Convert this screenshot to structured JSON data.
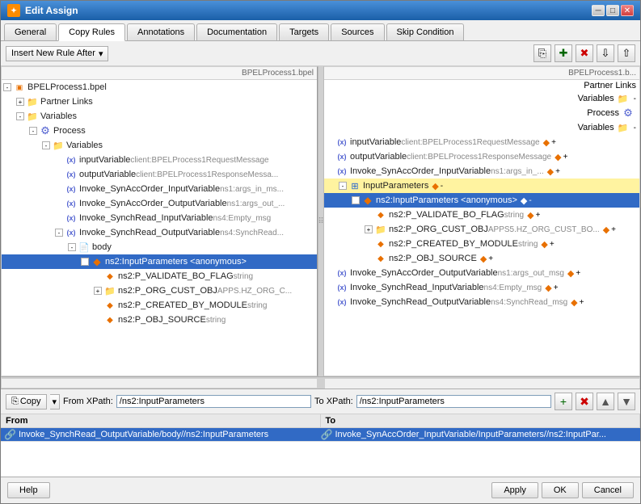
{
  "window": {
    "title": "Edit Assign",
    "icon": "✦"
  },
  "tabs": [
    {
      "id": "general",
      "label": "General",
      "active": false
    },
    {
      "id": "copy-rules",
      "label": "Copy Rules",
      "active": true
    },
    {
      "id": "annotations",
      "label": "Annotations",
      "active": false
    },
    {
      "id": "documentation",
      "label": "Documentation",
      "active": false
    },
    {
      "id": "targets",
      "label": "Targets",
      "active": false
    },
    {
      "id": "sources",
      "label": "Sources",
      "active": false
    },
    {
      "id": "skip-condition",
      "label": "Skip Condition",
      "active": false
    }
  ],
  "toolbar": {
    "insert_btn": "Insert New Rule After",
    "icons": [
      "copy",
      "add",
      "delete",
      "import",
      "export"
    ]
  },
  "left_panel": {
    "header": "BPELProcess1.bpel",
    "nodes": [
      {
        "id": "bpel",
        "indent": 0,
        "exp": "-",
        "icon": "bpel",
        "text": "BPELProcess1.bpel",
        "gray": ""
      },
      {
        "id": "pl",
        "indent": 1,
        "exp": "+",
        "icon": "folder",
        "text": "Partner Links",
        "gray": ""
      },
      {
        "id": "vars",
        "indent": 1,
        "exp": "-",
        "icon": "folder",
        "text": "Variables",
        "gray": ""
      },
      {
        "id": "proc",
        "indent": 2,
        "exp": "-",
        "icon": "proc",
        "text": "Process",
        "gray": ""
      },
      {
        "id": "pvars",
        "indent": 3,
        "exp": "-",
        "icon": "folder",
        "text": "Variables",
        "gray": ""
      },
      {
        "id": "inpv",
        "indent": 4,
        "exp": null,
        "icon": "var",
        "text": "inputVariable",
        "gray": "client:BPELProcess1RequestMessage"
      },
      {
        "id": "outv",
        "indent": 4,
        "exp": null,
        "icon": "var",
        "text": "outputVariable",
        "gray": "client:BPELProcess1ResponseMessage"
      },
      {
        "id": "invokeinp",
        "indent": 4,
        "exp": null,
        "icon": "var",
        "text": "Invoke_SynAccOrder_InputVariable",
        "gray": "ns1:args_in_ms..."
      },
      {
        "id": "invokeout",
        "indent": 4,
        "exp": null,
        "icon": "var",
        "text": "Invoke_SynAccOrder_OutputVariable",
        "gray": "ns1:args_out_..."
      },
      {
        "id": "synchread",
        "indent": 4,
        "exp": null,
        "icon": "var",
        "text": "Invoke_SynchRead_InputVariable",
        "gray": "ns4:Empty_msg"
      },
      {
        "id": "synchreadout",
        "indent": 4,
        "exp": "-",
        "icon": "var",
        "text": "Invoke_SynchRead_OutputVariable",
        "gray": "ns4:SynchRead..."
      },
      {
        "id": "body",
        "indent": 5,
        "exp": "-",
        "icon": "body",
        "text": "body",
        "gray": ""
      },
      {
        "id": "ns2inp",
        "indent": 6,
        "exp": "-",
        "icon": "orange",
        "text": "ns2:InputParameters <anonymous>",
        "gray": "",
        "selected": true
      },
      {
        "id": "p_validate",
        "indent": 7,
        "exp": null,
        "icon": "orange",
        "text": "ns2:P_VALIDATE_BO_FLAG",
        "gray": "string"
      },
      {
        "id": "p_org",
        "indent": 7,
        "exp": null,
        "icon": "folder",
        "text": "ns2:P_ORG_CUST_OBJ",
        "gray": "APPS.HZ_ORG_C..."
      },
      {
        "id": "p_created",
        "indent": 7,
        "exp": null,
        "icon": "orange",
        "text": "ns2:P_CREATED_BY_MODULE",
        "gray": "string"
      },
      {
        "id": "p_obj",
        "indent": 7,
        "exp": null,
        "icon": "orange",
        "text": "ns2:P_OBJ_SOURCE",
        "gray": "string"
      }
    ]
  },
  "right_panel": {
    "header": "BPELProcess1.b...",
    "nodes": [
      {
        "id": "pl2",
        "text": "Partner Links",
        "align": "right"
      },
      {
        "id": "vars2",
        "text": "Variables",
        "align": "right"
      },
      {
        "id": "proc2",
        "text": "Process",
        "align": "right",
        "icon": "proc"
      },
      {
        "id": "pvars2",
        "text": "Variables",
        "align": "right",
        "icon": "folder",
        "exp": "-"
      },
      {
        "id": "inpv2",
        "text": "inputVariable",
        "gray": "client:BPELProcess1RequestMessage"
      },
      {
        "id": "outv2",
        "text": "outputVariable",
        "gray": "client:BPELProcess1ResponseMessage"
      },
      {
        "id": "invokeinp2",
        "text": "Invoke_SynAccOrder_InputVariable",
        "gray": "ns1:args_in_..."
      },
      {
        "id": "inpparams",
        "text": "InputParameters",
        "gray": "",
        "icon": "table",
        "selected": true,
        "exp": "-"
      },
      {
        "id": "ns2inp2",
        "text": "ns2:InputParameters <anonymous>",
        "gray": "",
        "icon": "orange",
        "selected": true
      },
      {
        "id": "p_validate2",
        "text": "ns2:P_VALIDATE_BO_FLAG",
        "gray": "string",
        "icon": "orange"
      },
      {
        "id": "p_org2",
        "text": "ns2:P_ORG_CUST_OBJ",
        "gray": "APPS5.HZ_ORG_CUST_BO...",
        "icon": "folder"
      },
      {
        "id": "p_created2",
        "text": "ns2:P_CREATED_BY_MODULE",
        "gray": "string",
        "icon": "orange"
      },
      {
        "id": "p_obj2",
        "text": "ns2:P_OBJ_SOURCE",
        "gray": "",
        "icon": "orange"
      },
      {
        "id": "invokeout2",
        "text": "Invoke_SynAccOrder_OutputVariable",
        "gray": "ns1:args_out_msg",
        "icon": "var"
      },
      {
        "id": "synchread2",
        "text": "Invoke_SynchRead_InputVariable",
        "gray": "ns4:Empty_msg",
        "icon": "var"
      },
      {
        "id": "synchreadout2",
        "text": "Invoke_SynchRead_OutputVariable",
        "gray": "ns4:SynchRead_msg",
        "icon": "var"
      }
    ]
  },
  "copy_bar": {
    "copy_label": "Copy",
    "from_label": "From XPath:",
    "from_value": "/ns2:InputParameters",
    "to_label": "To XPath:",
    "to_value": "/ns2:InputParameters"
  },
  "table": {
    "col_from": "From",
    "col_to": "To",
    "rows": [
      {
        "from_icon": "var",
        "from_text": "Invoke_SynchRead_OutputVariable/body//ns2:InputParameters",
        "to_icon": "var",
        "to_text": "Invoke_SynAccOrder_InputVariable/InputParameters//ns2:InputPar...",
        "selected": true
      }
    ]
  },
  "footer": {
    "help": "Help",
    "apply": "Apply",
    "ok": "OK",
    "cancel": "Cancel"
  }
}
